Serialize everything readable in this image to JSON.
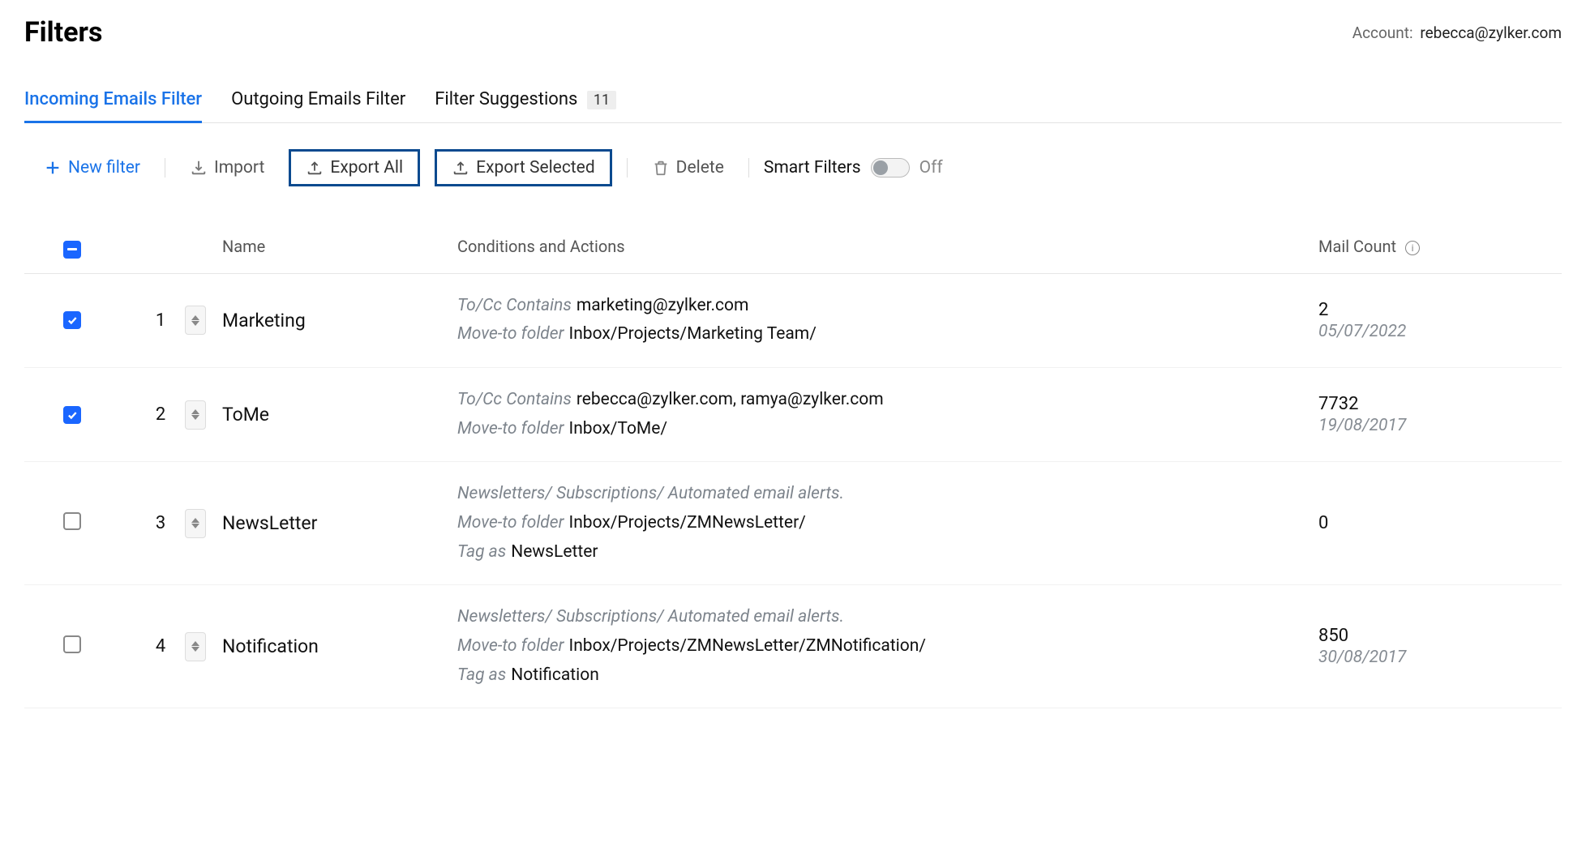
{
  "header": {
    "title": "Filters",
    "account_label": "Account:",
    "account_email": "rebecca@zylker.com"
  },
  "tabs": {
    "incoming": "Incoming Emails Filter",
    "outgoing": "Outgoing Emails Filter",
    "suggestions": "Filter Suggestions",
    "suggestions_count": "11"
  },
  "toolbar": {
    "new_filter": "New filter",
    "import": "Import",
    "export_all": "Export All",
    "export_selected": "Export Selected",
    "delete": "Delete",
    "smart_filters_label": "Smart Filters",
    "smart_filters_state": "Off"
  },
  "columns": {
    "name": "Name",
    "conditions": "Conditions and Actions",
    "mail_count": "Mail Count"
  },
  "condition_labels": {
    "to_cc_contains": "To/Cc Contains",
    "move_to_folder": "Move-to folder",
    "tag_as": "Tag as",
    "newsletter_note": "Newsletters/ Subscriptions/ Automated email alerts."
  },
  "rows": [
    {
      "checked": true,
      "index": "1",
      "name": "Marketing",
      "to_cc": "marketing@zylker.com",
      "move_to": "Inbox/Projects/Marketing Team/",
      "count": "2",
      "date": "05/07/2022"
    },
    {
      "checked": true,
      "index": "2",
      "name": "ToMe",
      "to_cc": "rebecca@zylker.com, ramya@zylker.com",
      "move_to": "Inbox/ToMe/",
      "count": "7732",
      "date": "19/08/2017"
    },
    {
      "checked": false,
      "index": "3",
      "name": "NewsLetter",
      "note": true,
      "move_to": "Inbox/Projects/ZMNewsLetter/",
      "tag_as": "NewsLetter",
      "count": "0",
      "date": ""
    },
    {
      "checked": false,
      "index": "4",
      "name": "Notification",
      "note": true,
      "move_to": "Inbox/Projects/ZMNewsLetter/ZMNotification/",
      "tag_as": "Notification",
      "count": "850",
      "date": "30/08/2017"
    }
  ]
}
